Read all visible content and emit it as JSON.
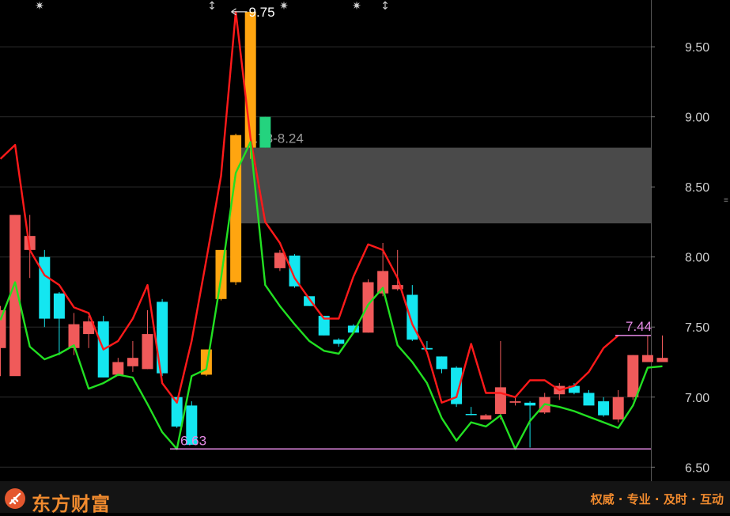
{
  "header_icons": [
    "gear-icon",
    "arrows-icon",
    "gear-icon",
    "gear-icon",
    "arrows-icon"
  ],
  "footer": {
    "brand": "东方财富",
    "slogan": "权威 · 专业 · 及时 · 互动"
  },
  "chart_data": {
    "type": "candlestick",
    "ylim": [
      6.4,
      9.8
    ],
    "yticks": [
      "9.50",
      "9.00",
      "8.50",
      "8.00",
      "7.50",
      "7.00",
      "6.50"
    ],
    "ytick_values": [
      9.5,
      9.0,
      8.5,
      8.0,
      7.5,
      7.0,
      6.5
    ],
    "colors": {
      "up": "#f05a5a",
      "down": "#14e6f0",
      "up_strong": "#ffa510",
      "down_strong": "#24d37e",
      "upper_band": "#ff1a1a",
      "lower_band": "#22e022",
      "marker": "#e58ae5",
      "zone": "#4a4a4a"
    },
    "candles": [
      {
        "o": 7.35,
        "h": 7.65,
        "l": 7.15,
        "c": 7.62,
        "color": "up"
      },
      {
        "o": 7.15,
        "h": 8.3,
        "l": 7.5,
        "c": 8.3,
        "color": "up"
      },
      {
        "o": 8.05,
        "h": 8.3,
        "l": 7.85,
        "c": 8.15,
        "color": "up"
      },
      {
        "o": 8.0,
        "h": 8.05,
        "l": 7.5,
        "c": 7.56,
        "color": "down"
      },
      {
        "o": 7.56,
        "h": 7.75,
        "l": 7.3,
        "c": 7.74,
        "color": "down"
      },
      {
        "o": 7.35,
        "h": 7.6,
        "l": 7.3,
        "c": 7.52,
        "color": "up"
      },
      {
        "o": 7.45,
        "h": 7.58,
        "l": 7.35,
        "c": 7.54,
        "color": "up"
      },
      {
        "o": 7.54,
        "h": 7.58,
        "l": 7.14,
        "c": 7.14,
        "color": "down"
      },
      {
        "o": 7.16,
        "h": 7.28,
        "l": 7.15,
        "c": 7.25,
        "color": "up"
      },
      {
        "o": 7.22,
        "h": 7.4,
        "l": 7.18,
        "c": 7.28,
        "color": "up"
      },
      {
        "o": 7.2,
        "h": 7.62,
        "l": 7.2,
        "c": 7.45,
        "color": "up"
      },
      {
        "o": 7.68,
        "h": 7.7,
        "l": 7.15,
        "c": 7.17,
        "color": "down"
      },
      {
        "o": 7.0,
        "h": 7.0,
        "l": 6.78,
        "c": 6.79,
        "color": "down"
      },
      {
        "o": 6.94,
        "h": 6.97,
        "l": 6.66,
        "c": 6.66,
        "color": "down"
      },
      {
        "o": 7.16,
        "h": 7.34,
        "l": 7.15,
        "c": 7.34,
        "color": "up_strong"
      },
      {
        "o": 7.7,
        "h": 8.05,
        "l": 7.69,
        "c": 8.05,
        "color": "up_strong"
      },
      {
        "o": 7.82,
        "h": 8.88,
        "l": 7.8,
        "c": 8.87,
        "color": "up_strong"
      },
      {
        "o": 8.78,
        "h": 9.75,
        "l": 8.7,
        "c": 9.75,
        "color": "up_strong"
      },
      {
        "o": 9.0,
        "h": 9.0,
        "l": 8.78,
        "c": 8.78,
        "color": "down_strong"
      },
      {
        "o": 7.92,
        "h": 8.05,
        "l": 7.9,
        "c": 8.03,
        "color": "up"
      },
      {
        "o": 8.01,
        "h": 8.02,
        "l": 7.78,
        "c": 7.79,
        "color": "down"
      },
      {
        "o": 7.72,
        "h": 7.72,
        "l": 7.65,
        "c": 7.65,
        "color": "down"
      },
      {
        "o": 7.58,
        "h": 7.58,
        "l": 7.44,
        "c": 7.44,
        "color": "down"
      },
      {
        "o": 7.41,
        "h": 7.42,
        "l": 7.36,
        "c": 7.38,
        "color": "down"
      },
      {
        "o": 7.51,
        "h": 7.52,
        "l": 7.45,
        "c": 7.46,
        "color": "down"
      },
      {
        "o": 7.46,
        "h": 7.84,
        "l": 7.46,
        "c": 7.82,
        "color": "up"
      },
      {
        "o": 7.74,
        "h": 8.1,
        "l": 7.72,
        "c": 7.9,
        "color": "up"
      },
      {
        "o": 7.77,
        "h": 8.05,
        "l": 7.76,
        "c": 7.8,
        "color": "up"
      },
      {
        "o": 7.73,
        "h": 7.8,
        "l": 7.4,
        "c": 7.41,
        "color": "down"
      },
      {
        "o": 7.35,
        "h": 7.4,
        "l": 7.34,
        "c": 7.34,
        "color": "down"
      },
      {
        "o": 7.29,
        "h": 7.29,
        "l": 7.17,
        "c": 7.2,
        "color": "down"
      },
      {
        "o": 7.21,
        "h": 7.22,
        "l": 6.93,
        "c": 6.95,
        "color": "down"
      },
      {
        "o": 6.88,
        "h": 6.93,
        "l": 6.87,
        "c": 6.88,
        "color": "down"
      },
      {
        "o": 6.84,
        "h": 6.88,
        "l": 6.84,
        "c": 6.87,
        "color": "up"
      },
      {
        "o": 6.88,
        "h": 7.4,
        "l": 6.84,
        "c": 7.07,
        "color": "up"
      },
      {
        "o": 6.96,
        "h": 7.0,
        "l": 6.94,
        "c": 6.97,
        "color": "up"
      },
      {
        "o": 6.96,
        "h": 6.97,
        "l": 6.64,
        "c": 6.94,
        "color": "down"
      },
      {
        "o": 6.89,
        "h": 7.03,
        "l": 6.88,
        "c": 7.0,
        "color": "up"
      },
      {
        "o": 7.02,
        "h": 7.1,
        "l": 6.98,
        "c": 7.08,
        "color": "up"
      },
      {
        "o": 7.08,
        "h": 7.1,
        "l": 7.02,
        "c": 7.03,
        "color": "down"
      },
      {
        "o": 7.03,
        "h": 7.05,
        "l": 6.95,
        "c": 6.94,
        "color": "down"
      },
      {
        "o": 6.97,
        "h": 7.0,
        "l": 6.86,
        "c": 6.87,
        "color": "down"
      },
      {
        "o": 6.84,
        "h": 7.05,
        "l": 6.82,
        "c": 7.0,
        "color": "up"
      },
      {
        "o": 7.0,
        "h": 7.3,
        "l": 6.98,
        "c": 7.3,
        "color": "up"
      },
      {
        "o": 7.25,
        "h": 7.44,
        "l": 7.25,
        "c": 7.3,
        "color": "up"
      },
      {
        "o": 7.25,
        "h": 7.44,
        "l": 7.25,
        "c": 7.28,
        "color": "up"
      }
    ],
    "upper_band": [
      8.7,
      8.8,
      8.05,
      7.87,
      7.8,
      7.64,
      7.6,
      7.34,
      7.4,
      7.56,
      7.8,
      7.1,
      6.96,
      7.4,
      7.98,
      8.58,
      9.75,
      8.85,
      8.25,
      8.1,
      7.85,
      7.7,
      7.56,
      7.56,
      7.86,
      8.09,
      8.05,
      7.85,
      7.52,
      7.32,
      6.96,
      7.0,
      7.38,
      7.03,
      7.03,
      7.0,
      7.12,
      7.12,
      7.05,
      7.08,
      7.18,
      7.35,
      7.44
    ],
    "lower_band": [
      7.55,
      7.82,
      7.36,
      7.27,
      7.31,
      7.37,
      7.06,
      7.1,
      7.16,
      7.14,
      6.95,
      6.75,
      6.63,
      7.15,
      7.2,
      7.85,
      8.6,
      8.82,
      7.8,
      7.65,
      7.52,
      7.4,
      7.33,
      7.31,
      7.46,
      7.66,
      7.78,
      7.37,
      7.25,
      7.1,
      6.85,
      6.69,
      6.82,
      6.79,
      6.87,
      6.63,
      6.83,
      6.95,
      6.93,
      6.9,
      6.86,
      6.82,
      6.78,
      6.94,
      7.21,
      7.22
    ],
    "high_label": "9.75",
    "low_label": "6.63",
    "low_value": 6.63,
    "last_label": "7.44",
    "last_value": 7.44,
    "zone": {
      "label": "8.78-8.24",
      "top": 8.78,
      "bottom": 8.24
    }
  }
}
